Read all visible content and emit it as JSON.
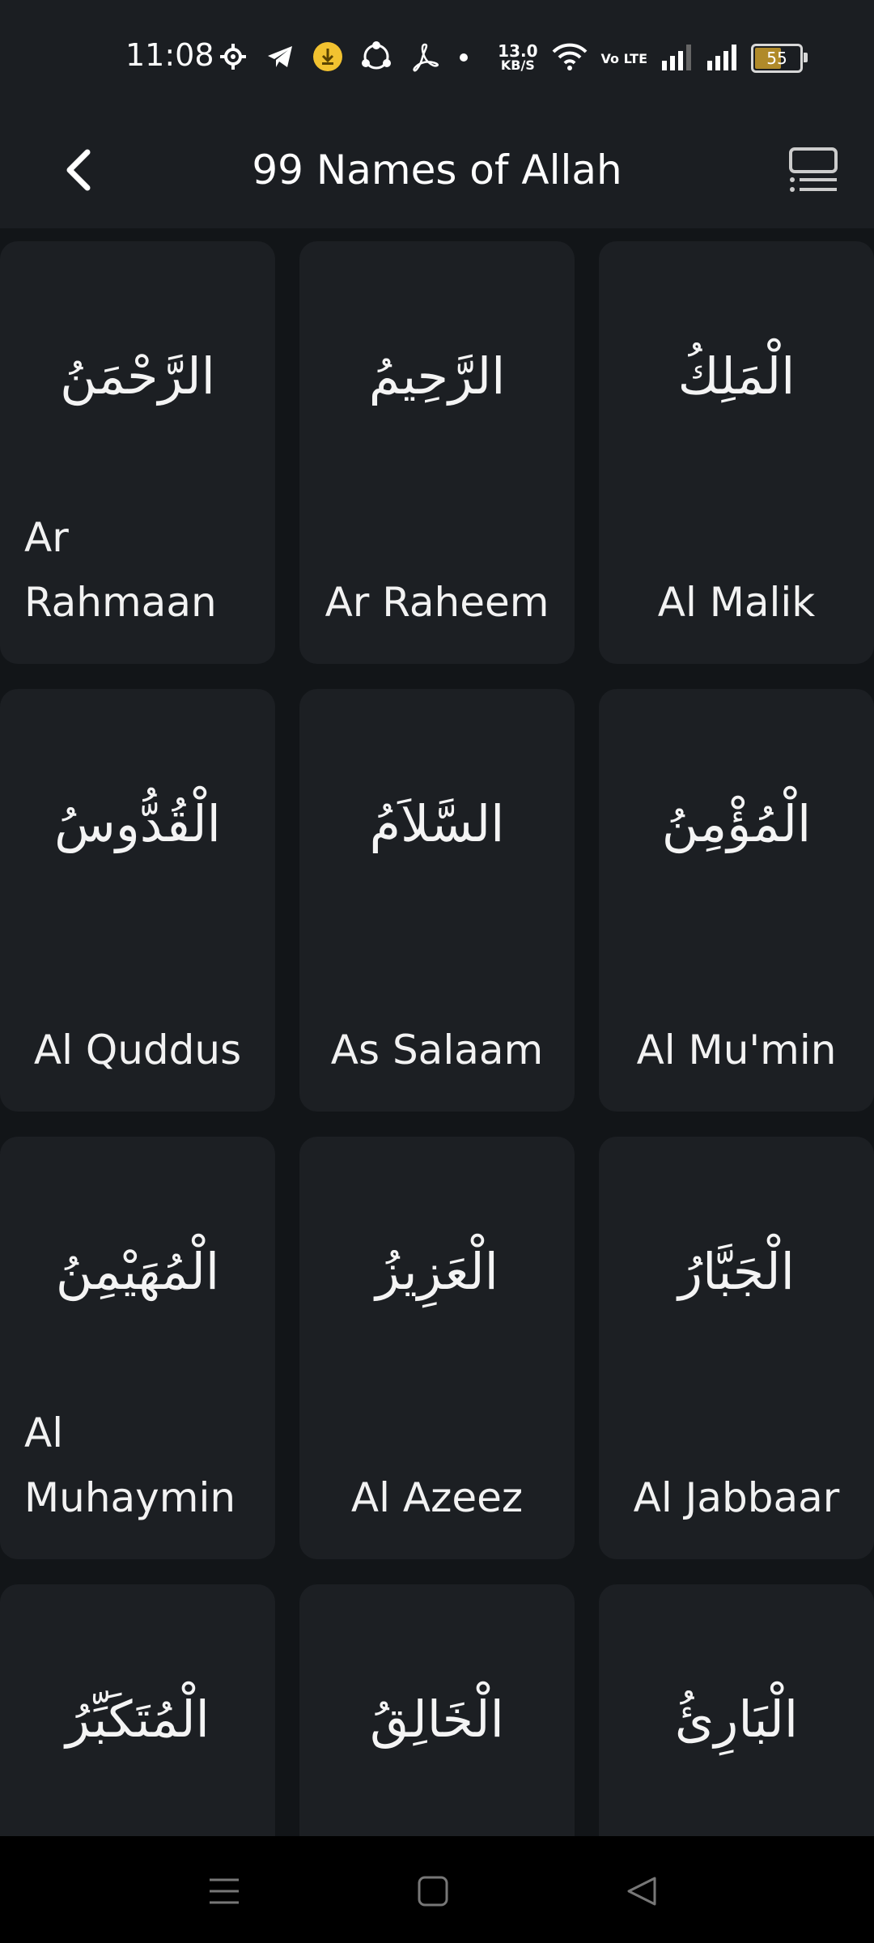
{
  "status_bar": {
    "time": "11:08",
    "speed_value": "13.0",
    "speed_unit": "KB/S",
    "volte": "Vo LTE",
    "battery": "55",
    "icons": [
      "gear-icon",
      "telegram-icon",
      "download-icon",
      "share-icon",
      "pdf-icon",
      "dot-icon",
      "wifi-icon",
      "signal-icon",
      "signal-icon",
      "battery-icon"
    ]
  },
  "appbar": {
    "title": "99 Names of Allah",
    "back_icon": "chevron-left-icon",
    "view_icon": "list-view-icon"
  },
  "names": [
    {
      "arabic": "الرَّحْمَنُ",
      "translit": "Ar Rahmaan"
    },
    {
      "arabic": "الرَّحِيمُ",
      "translit": "Ar Raheem"
    },
    {
      "arabic": "الْمَلِكُ",
      "translit": "Al Malik"
    },
    {
      "arabic": "الْقُدُّوسُ",
      "translit": "Al Quddus"
    },
    {
      "arabic": "السَّلاَمُ",
      "translit": "As Salaam"
    },
    {
      "arabic": "الْمُؤْمِنُ",
      "translit": "Al Mu'min"
    },
    {
      "arabic": "الْمُهَيْمِنُ",
      "translit": "Al Muhaymin"
    },
    {
      "arabic": "الْعَزِيزُ",
      "translit": "Al Azeez"
    },
    {
      "arabic": "الْجَبَّارُ",
      "translit": "Al Jabbaar"
    },
    {
      "arabic": "الْمُتَكَبِّرُ",
      "translit": ""
    },
    {
      "arabic": "الْخَالِقُ",
      "translit": ""
    },
    {
      "arabic": "الْبَارِئُ",
      "translit": ""
    }
  ],
  "navbar": {
    "items": [
      "menu-icon",
      "home-square-icon",
      "back-triangle-icon"
    ]
  },
  "colors": {
    "background": "#121518",
    "card": "#1c1f23",
    "bar": "#1b1e22",
    "text": "#ffffff"
  }
}
